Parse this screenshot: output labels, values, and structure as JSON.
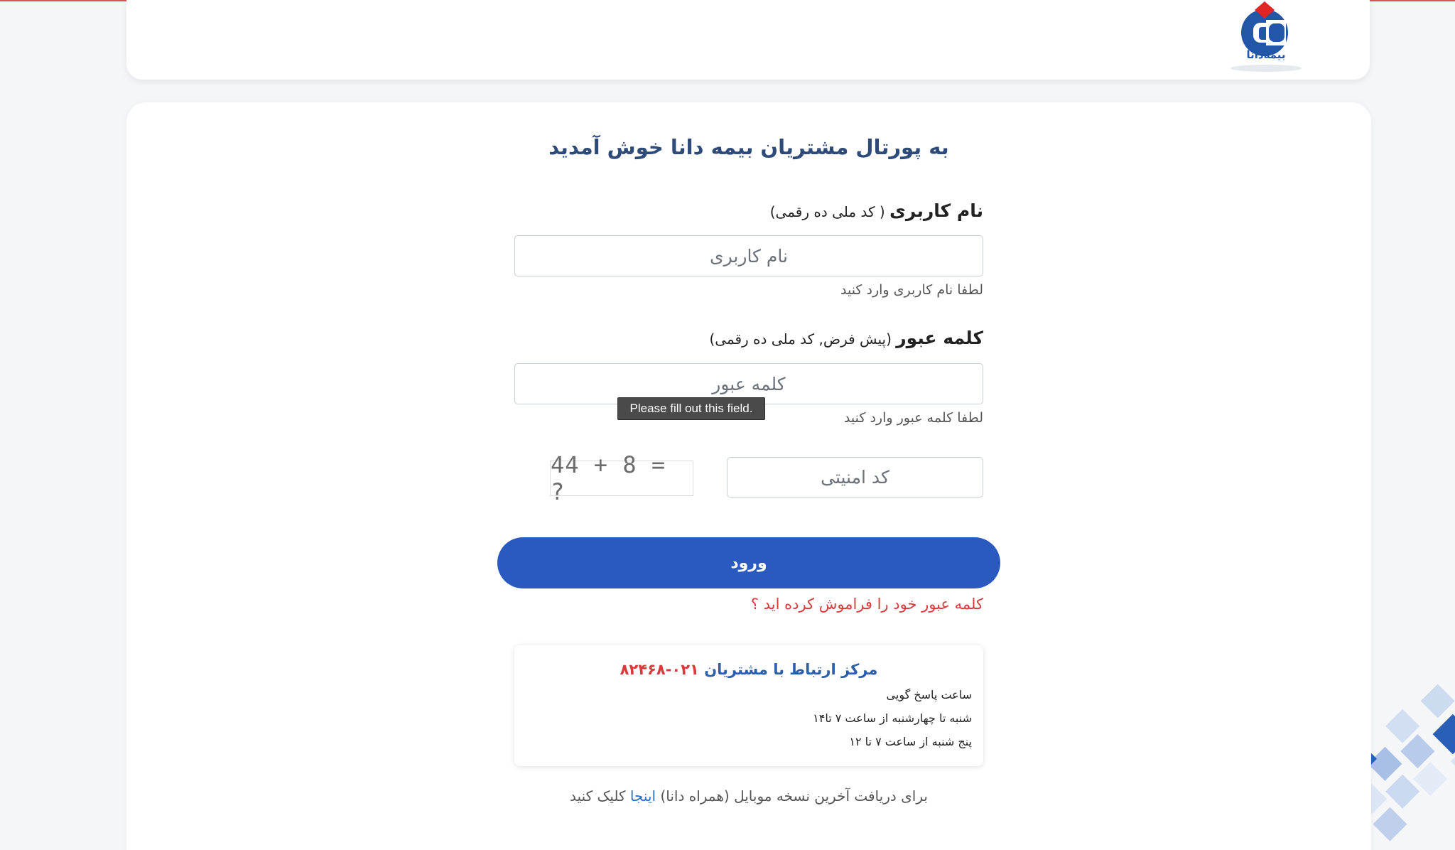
{
  "header": {
    "logo_text": "بیمه‌دانا"
  },
  "login": {
    "title": "به پورتال مشتریان بیمه دانا خوش آمدید",
    "username": {
      "label_bold": "نام کاربری",
      "label_note": " ( کد ملی ده رقمی)",
      "placeholder": "نام کاربری",
      "hint": "لطفا نام کاربری وارد کنید"
    },
    "password": {
      "label_bold": "کلمه عبور",
      "label_note": " (پیش فرض, کد ملی ده رقمی)",
      "placeholder": "کلمه عبور",
      "hint": "لطفا کلمه عبور وارد کنید",
      "tooltip": "Please fill out this field."
    },
    "captcha": {
      "question": "44 + 8 = ?",
      "placeholder": "کد امنیتی"
    },
    "submit_label": "ورود",
    "forgot_label": "کلمه عبور خود را فراموش کرده اید ؟"
  },
  "support": {
    "title": "مرکز ارتباط با مشتریان",
    "phone": "۰۲۱-۸۲۴۶۸",
    "hours_label": "ساعت پاسخ گویی",
    "weekdays": "شنبه تا چهارشنبه از ساعت ۷ تا۱۴",
    "thursday": "پنج شنبه از ساعت ۷ تا ۱۲"
  },
  "footer": {
    "text_before": "برای دریافت آخرین نسخه موبایل (همراه دانا) ",
    "link": "اینجا",
    "text_after": " کلیک کنید"
  },
  "colors": {
    "primary": "#2a5ac0",
    "title": "#2d4a78",
    "danger": "#d63a3a",
    "link": "#2a6fc9"
  }
}
